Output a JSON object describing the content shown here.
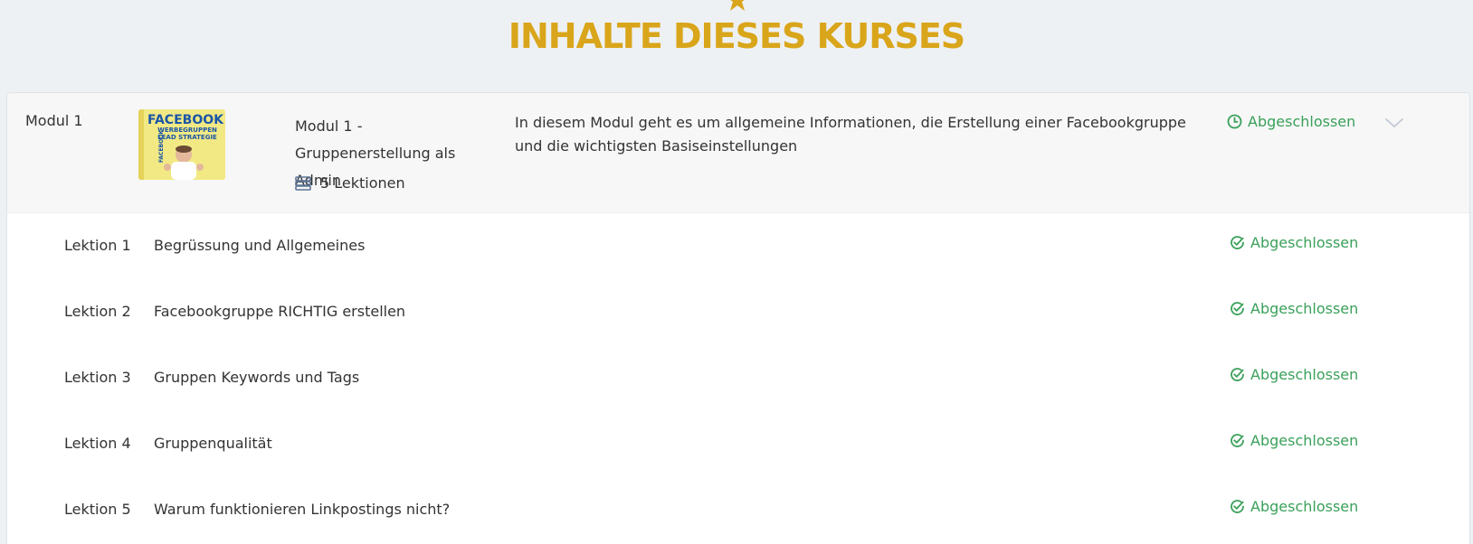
{
  "heading": "INHALTE DIESES KURSES",
  "colors": {
    "accent": "#d9a51a",
    "success": "#3aa05a"
  },
  "module": {
    "label": "Modul 1",
    "thumbnail_text": "FACEBOOK WERBEGRUPPEN LEAD STRATEGIE",
    "title": "Modul 1 - Gruppenerstellung als Admin",
    "lessons_count": "5 Lektionen",
    "description": "In diesem Modul geht es um allgemeine Informationen, die Erstellung einer Facebookgruppe und die wichtigsten Basiseinstellungen",
    "status": "Abgeschlossen"
  },
  "lessons": [
    {
      "number": "Lektion 1",
      "title": "Begrüssung und Allgemeines",
      "status": "Abgeschlossen"
    },
    {
      "number": "Lektion 2",
      "title": "Facebookgruppe RICHTIG erstellen",
      "status": "Abgeschlossen"
    },
    {
      "number": "Lektion 3",
      "title": "Gruppen Keywords und Tags",
      "status": "Abgeschlossen"
    },
    {
      "number": "Lektion 4",
      "title": "Gruppenqualität",
      "status": "Abgeschlossen"
    },
    {
      "number": "Lektion 5",
      "title": "Warum funktionieren Linkpostings nicht?",
      "status": "Abgeschlossen"
    }
  ]
}
